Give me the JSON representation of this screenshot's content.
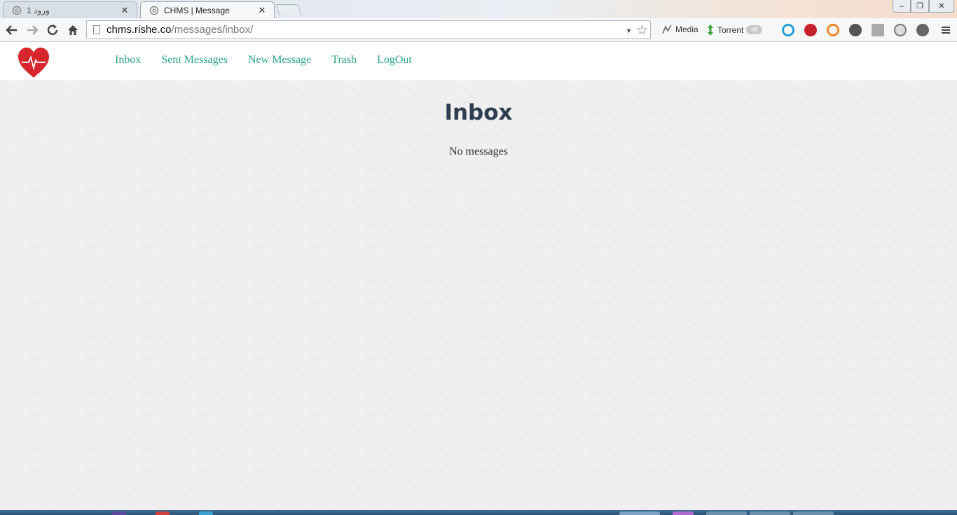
{
  "browser": {
    "tabs": [
      {
        "title": "ورود 1",
        "active": false
      },
      {
        "title": "CHMS | Message",
        "active": true
      }
    ],
    "url_host": "chms.rishe.co",
    "url_path": "/messages/inbox/",
    "extensions": {
      "media_label": "Media",
      "torrent_label": "Torrent",
      "toggle_label": "off"
    }
  },
  "site": {
    "nav": [
      {
        "label": "Inbox"
      },
      {
        "label": "Sent Messages"
      },
      {
        "label": "New Message"
      },
      {
        "label": "Trash"
      },
      {
        "label": "LogOut"
      }
    ],
    "accent_color": "#2aa58a",
    "logo_color": "#d7262e"
  },
  "main": {
    "title": "Inbox",
    "empty_message": "No messages"
  }
}
